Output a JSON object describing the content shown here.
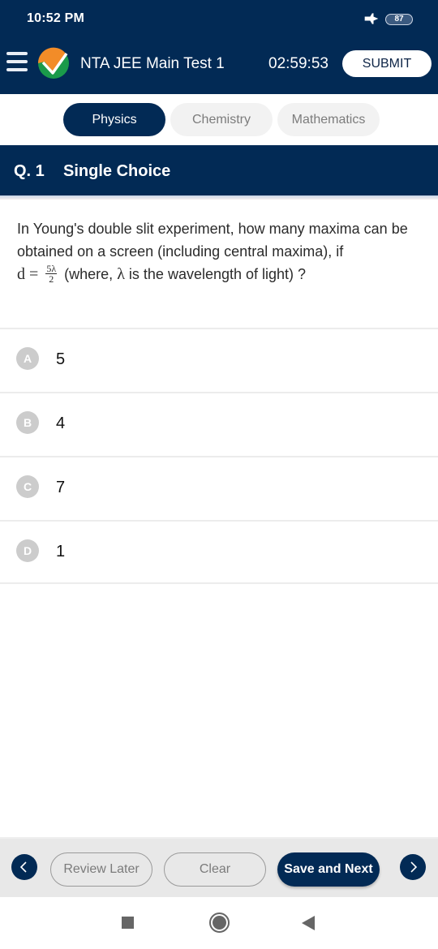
{
  "status_bar": {
    "time": "10:52 PM",
    "airplane_icon": "airplane-mode-icon",
    "battery_level": "87"
  },
  "app_bar": {
    "menu_icon": "hamburger-menu-icon",
    "logo_icon": "nta-logo-icon",
    "title": "NTA JEE Main Test 1",
    "timer": "02:59:53",
    "submit_label": "SUBMIT"
  },
  "subject_tabs": [
    {
      "label": "Physics",
      "active": true
    },
    {
      "label": "Chemistry",
      "active": false
    },
    {
      "label": "Mathematics",
      "active": false
    }
  ],
  "question": {
    "number": "Q. 1",
    "type": "Single Choice",
    "text_line1": "In Young's double slit experiment, how many maxima can be obtained on a screen (including central maxima), if",
    "math_var": "d",
    "math_eq": "=",
    "frac_num": "5λ",
    "frac_den": "2",
    "text_after": "(where,",
    "lambda": "λ",
    "text_end": "is the wavelength of light) ?"
  },
  "options": [
    {
      "letter": "A",
      "value": "5"
    },
    {
      "letter": "B",
      "value": "4"
    },
    {
      "letter": "C",
      "value": "7"
    },
    {
      "letter": "D",
      "value": "1"
    }
  ],
  "bottom_bar": {
    "prev_icon": "chevron-left-icon",
    "review_later_label": "Review Later",
    "clear_label": "Clear",
    "save_next_label": "Save and Next",
    "next_icon": "chevron-right-icon"
  },
  "system_nav": {
    "recents_icon": "recents-square-icon",
    "home_icon": "home-circle-icon",
    "back_icon": "back-triangle-icon"
  },
  "colors": {
    "primary": "#022a55",
    "inactive_tab_bg": "#f2f2f2",
    "option_letter_bg": "#cccccc",
    "bottom_bar_bg": "#e8e8e8"
  }
}
